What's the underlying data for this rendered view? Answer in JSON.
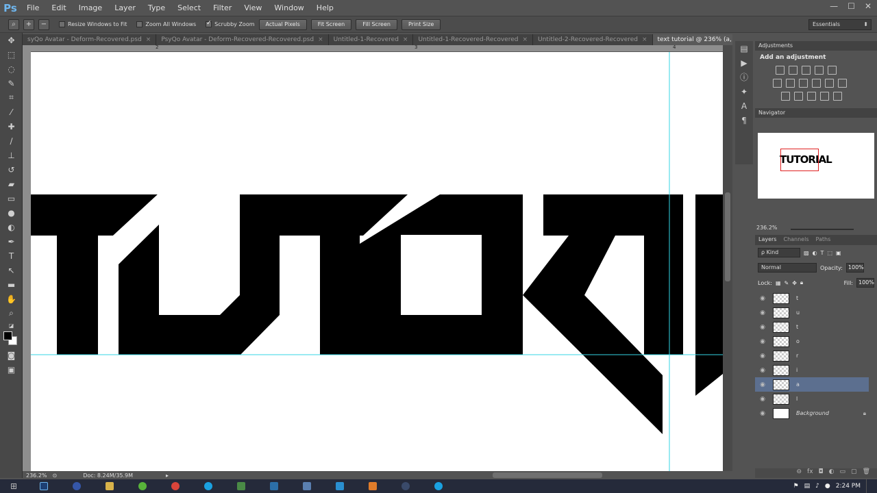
{
  "app": {
    "logo": "Ps"
  },
  "menu": [
    "File",
    "Edit",
    "Image",
    "Layer",
    "Type",
    "Select",
    "Filter",
    "View",
    "Window",
    "Help"
  ],
  "window_controls": [
    "—",
    "☐",
    "✕"
  ],
  "options": {
    "checks": [
      {
        "label": "Resize Windows to Fit",
        "checked": false
      },
      {
        "label": "Zoom All Windows",
        "checked": false
      },
      {
        "label": "Scrubby Zoom",
        "checked": true
      }
    ],
    "buttons": [
      "Actual Pixels",
      "Fit Screen",
      "Fill Screen",
      "Print Size"
    ],
    "workspace": "Essentials"
  },
  "tabs": [
    {
      "label": "syQo Avatar - Deform-Recovered.psd",
      "active": false
    },
    {
      "label": "PsyQo Avatar - Deform-Recovered-Recovered.psd",
      "active": false
    },
    {
      "label": "Untitled-1-Recovered",
      "active": false
    },
    {
      "label": "Untitled-1-Recovered-Recovered",
      "active": false
    },
    {
      "label": "Untitled-2-Recovered-Recovered",
      "active": false
    },
    {
      "label": "text tutorial @ 236% (a, RGB/16) *",
      "active": true
    }
  ],
  "tab_overflow": "»",
  "ruler_top": [
    "2",
    "3",
    "4"
  ],
  "status": {
    "zoom": "236.2%",
    "doc": "Doc: 8.24M/35.9M"
  },
  "adjustments": {
    "tab": "Adjustments",
    "title": "Add an adjustment"
  },
  "navigator": {
    "tab": "Navigator",
    "preview_text": "TUTORIAL",
    "zoom": "236.2%"
  },
  "layers_panel": {
    "tabs": [
      "Layers",
      "Channels",
      "Paths"
    ],
    "kind": "ρ Kind",
    "blend_mode": "Normal",
    "opacity_label": "Opacity:",
    "opacity": "100%",
    "lock_label": "Lock:",
    "fill_label": "Fill:",
    "fill": "100%",
    "layers": [
      {
        "name": "t",
        "selected": false
      },
      {
        "name": "u",
        "selected": false
      },
      {
        "name": "t",
        "selected": false
      },
      {
        "name": "o",
        "selected": false
      },
      {
        "name": "r",
        "selected": false
      },
      {
        "name": "i",
        "selected": false
      },
      {
        "name": "a",
        "selected": true
      },
      {
        "name": "l",
        "selected": false
      },
      {
        "name": "Background",
        "selected": false,
        "locked": true
      }
    ]
  },
  "taskbar": {
    "time": "2:24 PM",
    "start": "⊞"
  }
}
